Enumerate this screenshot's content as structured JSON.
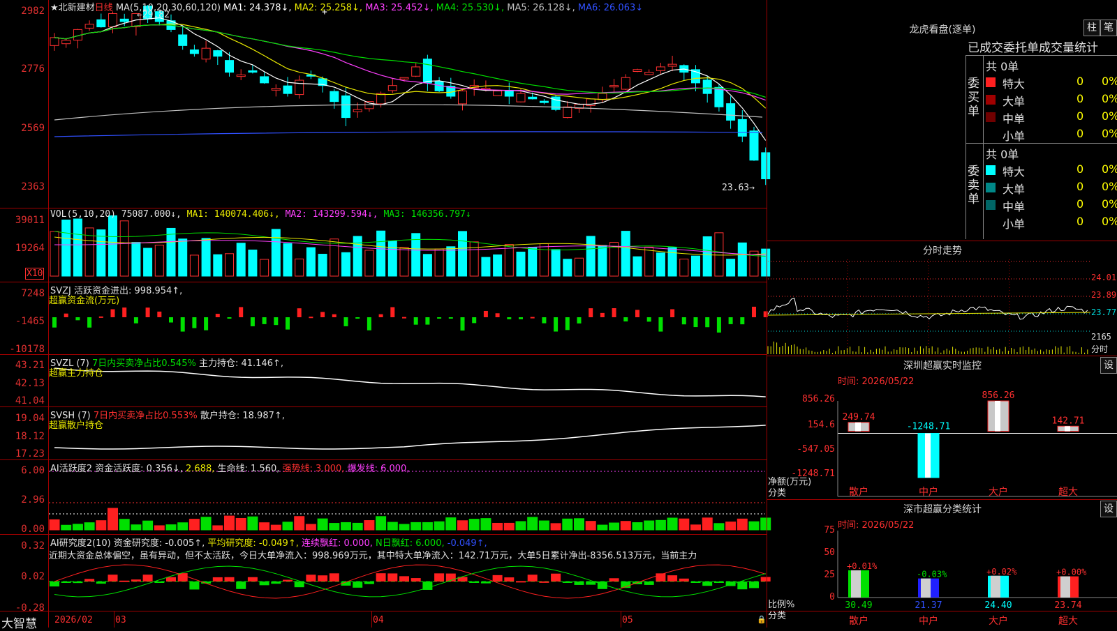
{
  "stock": {
    "title": "★北新建材",
    "period": "日线",
    "ma_header": "MA(5,10,20,30,60,120)",
    "high_label": "29.82",
    "low_label": "23.63"
  },
  "ma_values": [
    {
      "text": "MA1: 24.378↓,",
      "color": "#ffffff"
    },
    {
      "text": "MA2: 25.258↓,",
      "color": "#e8e800"
    },
    {
      "text": "MA3: 25.452↓,",
      "color": "#ff40ff"
    },
    {
      "text": "MA4: 25.530↓,",
      "color": "#00e000"
    },
    {
      "text": "MA5: 26.128↓,",
      "color": "#c0c0c0"
    },
    {
      "text": "MA6: 26.063↓",
      "color": "#3050ff"
    }
  ],
  "main_axis": [
    "2982",
    "2776",
    "2569",
    "2363"
  ],
  "vol": {
    "header": "VOL(5,10,20)",
    "value": "75087.000↓,",
    "ma1": "MA1: 140074.406↓,",
    "ma2": "MA2: 143299.594↓,",
    "ma3": "MA3: 146356.797↓",
    "axis": [
      "39011",
      "19264"
    ],
    "unit": "X10"
  },
  "svzj": {
    "line1": "SVZJ  活跃资金进出: 998.954↑,",
    "line2": "超赢资金流(万元)",
    "axis": [
      "7248",
      "-1465",
      "-10178"
    ]
  },
  "svzl": {
    "prefix": "SVZL (7)",
    "green": "7日内买卖净占比0.545%",
    "main": "主力持仓: 41.146↑,",
    "line2": "超赢主力持仓",
    "axis": [
      "43.21",
      "42.13",
      "41.04"
    ]
  },
  "svsh": {
    "prefix": "SVSH (7)",
    "red": "7日内买卖净占比0.553%",
    "main": "散户持仓: 18.987↑,",
    "line2": "超赢散户持仓",
    "axis": [
      "19.04",
      "18.12",
      "17.23"
    ]
  },
  "ai2": {
    "a": "AI活跃度2 资金活跃度: 0.356↓,",
    "b": "2.688,",
    "c": "生命线: 1.560,",
    "d": "强势线: 3.000,",
    "e": "爆发线: 6.000,",
    "axis": [
      "6.00",
      "2.96",
      "0.00"
    ]
  },
  "ai_res": {
    "a": "AI研究度2(10) 资金研究度: -0.005↑,",
    "b": "平均研究度: -0.049↑,",
    "c": "连续飘红: 0.000,",
    "d": "N日飘红: 6.000,",
    "e": "-0.049↑,",
    "summary": "近期大资金总体偏空，虽有异动，但不太活跃，今日大单净流入：998.969万元，其中特大单净流入：142.71万元，大单5日累计净出-8356.513万元，当前主力",
    "axis": [
      "0.32",
      "0.02",
      "-0.28"
    ]
  },
  "date_axis": {
    "brand": "大智慧",
    "labels": [
      "2026/02",
      "03",
      "04",
      "05"
    ]
  },
  "longhu": {
    "title": "龙虎看盘(逐单)",
    "tabs": [
      "柱",
      "笔"
    ],
    "header": "已成交委托单成交量统计",
    "buy": {
      "label": "委买单",
      "total": "共 0单",
      "rows": [
        {
          "name": "特大",
          "value": "0",
          "pct": "0%",
          "color": "#ff2020"
        },
        {
          "name": "大单",
          "value": "0",
          "pct": "0%",
          "color": "#a00000"
        },
        {
          "name": "中单",
          "value": "0",
          "pct": "0%",
          "color": "#700000"
        },
        {
          "name": "小单",
          "value": "0",
          "pct": "0%",
          "color": ""
        }
      ]
    },
    "sell": {
      "label": "委卖单",
      "total": "共 0单",
      "rows": [
        {
          "name": "特大",
          "value": "0",
          "pct": "0%",
          "color": "#00ffff"
        },
        {
          "name": "大单",
          "value": "0",
          "pct": "0%",
          "color": "#008888"
        },
        {
          "name": "中单",
          "value": "0",
          "pct": "0%",
          "color": "#006666"
        },
        {
          "name": "小单",
          "value": "0",
          "pct": "0%",
          "color": ""
        }
      ]
    }
  },
  "intraday": {
    "title": "分时走势",
    "axis": [
      "24.01",
      "23.89",
      "23.77",
      "2165",
      "分时"
    ]
  },
  "sz_monitor": {
    "title": "深圳超赢实时监控",
    "btn": "设",
    "time": "时间: 2026/05/22",
    "axis": [
      "856.26",
      "154.6",
      "-547.05",
      "-1248.71"
    ],
    "ylabel": "净额(万元)",
    "xlabel": "分类",
    "bars": [
      {
        "cat": "散户",
        "value": 249.74,
        "label": "249.74"
      },
      {
        "cat": "中户",
        "value": -1248.71,
        "label": "-1248.71"
      },
      {
        "cat": "大户",
        "value": 856.26,
        "label": "856.26"
      },
      {
        "cat": "超大",
        "value": 142.71,
        "label": "142.71"
      }
    ]
  },
  "sz_stats": {
    "title": "深市超赢分类统计",
    "btn": "设",
    "time": "时间: 2026/05/22",
    "axis": [
      "75",
      "50",
      "25",
      "0"
    ],
    "ylabel": "比例%",
    "xlabel": "分类",
    "bars": [
      {
        "cat": "散户",
        "value": 30.49,
        "label": "30.49",
        "delta": "+0.01%"
      },
      {
        "cat": "中户",
        "value": 21.37,
        "label": "21.37",
        "delta": "-0.03%"
      },
      {
        "cat": "大户",
        "value": 24.4,
        "label": "24.40",
        "delta": "+0.02%"
      },
      {
        "cat": "超大",
        "value": 23.74,
        "label": "23.74",
        "delta": "+0.00%"
      }
    ]
  }
}
